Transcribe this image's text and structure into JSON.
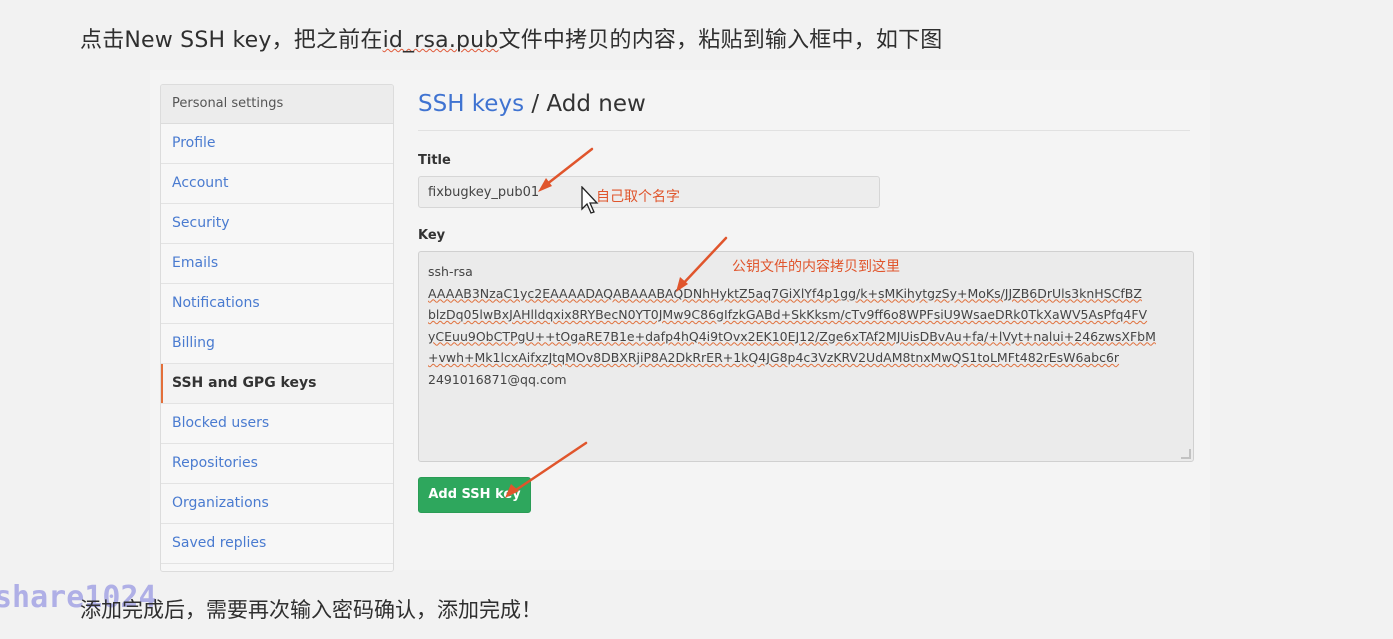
{
  "caption_top": {
    "before": "点击New SSH key，把之前在",
    "filename": "id_rsa.pub",
    "after": "文件中拷贝的内容，粘贴到输入框中，如下图"
  },
  "caption_bottom": "添加完成后，需要再次输入密码确认，添加完成！",
  "watermark": "share1024",
  "sidebar": {
    "header": "Personal settings",
    "items": [
      {
        "label": "Profile"
      },
      {
        "label": "Account"
      },
      {
        "label": "Security"
      },
      {
        "label": "Emails"
      },
      {
        "label": "Notifications"
      },
      {
        "label": "Billing"
      },
      {
        "label": "SSH and GPG keys"
      },
      {
        "label": "Blocked users"
      },
      {
        "label": "Repositories"
      },
      {
        "label": "Organizations"
      },
      {
        "label": "Saved replies"
      }
    ],
    "active_index": 6
  },
  "main": {
    "breadcrumb_link": "SSH keys",
    "breadcrumb_rest": " / Add new",
    "title_label": "Title",
    "title_value": "fixbugkey_pub01",
    "key_label": "Key",
    "key_lines": [
      "ssh-rsa",
      "AAAAB3NzaC1yc2EAAAADAQABAAABAQDNhHyktZ5aq7GiXlYf4p1gg/k+sMKihytgzSy+MoKs/JJZB6DrUls3knHSCfBZ",
      "blzDq05lwBxJAHlldqxix8RYBecN0YT0JMw9C86gIfzkGABd+SkKksm/cTv9ff6o8WPFsiU9WsaeDRk0TkXaWV5AsPfq4FV",
      "yCEuu9ObCTPgU++tOgaRE7B1e+dafp4hQ4i9tOvx2EK10EJ12/Zge6xTAf2MJUisDBvAu+fa/+lVyt+nalui+246zwsXFbM",
      "+vwh+Mk1lcxAifxzJtqMOv8DBXRjiP8A2DkRrER+1kQ4JG8p4c3VzKRV2UdAM8tnxMwQS1toLMFt482rEsW6abc6r",
      "2491016871@qq.com"
    ],
    "add_button_label": "Add SSH key"
  },
  "annotations": {
    "title_note": "自己取个名字",
    "key_note": "公钥文件的内容拷贝到这里",
    "color": "#e0552c"
  },
  "colors": {
    "link": "#3f73d1",
    "button": "#2ea75d",
    "active_accent": "#e36f3a"
  }
}
